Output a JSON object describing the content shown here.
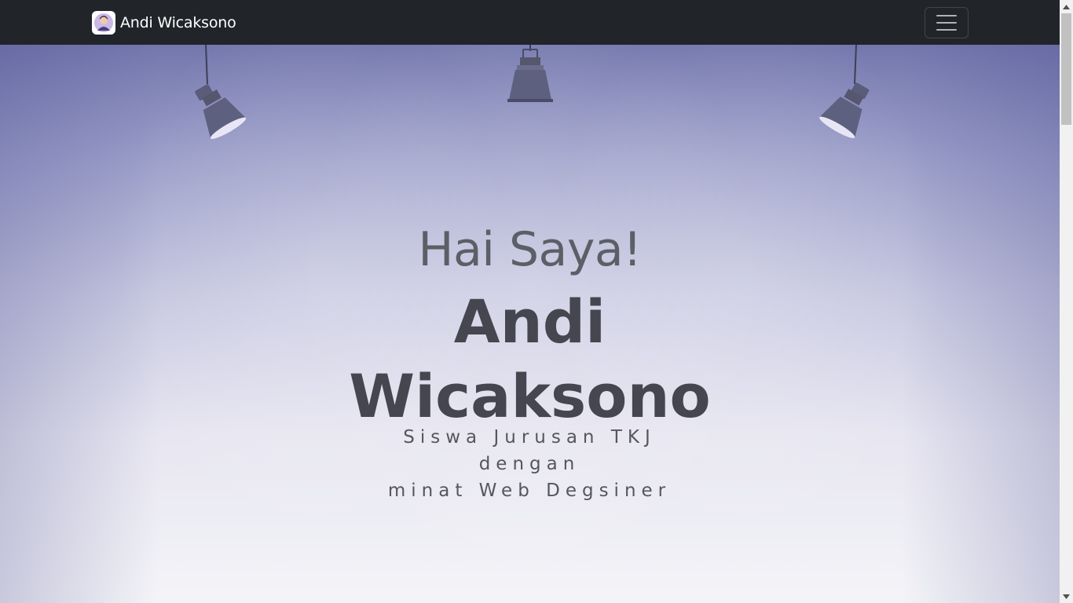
{
  "navbar": {
    "brand_name": "Andi Wicaksono",
    "brand_logo_icon": "avatar-icon",
    "toggler_icon": "hamburger-icon"
  },
  "hero": {
    "greeting": "Hai Saya!",
    "name_line1": "Andi",
    "name_line2": "Wicaksono",
    "tagline_line1": "Siswa Jurusan TKJ dengan",
    "tagline_line2": "minat Web Degsiner",
    "decor_icons": [
      "spotlight-icon",
      "spotlight-icon",
      "spotlight-icon"
    ]
  },
  "colors": {
    "navbar_bg": "#212529",
    "hero_top": "#7377ad",
    "hero_bottom": "#f4f4f8",
    "greeting_text": "#5d5e66",
    "name_text": "#45464f"
  }
}
